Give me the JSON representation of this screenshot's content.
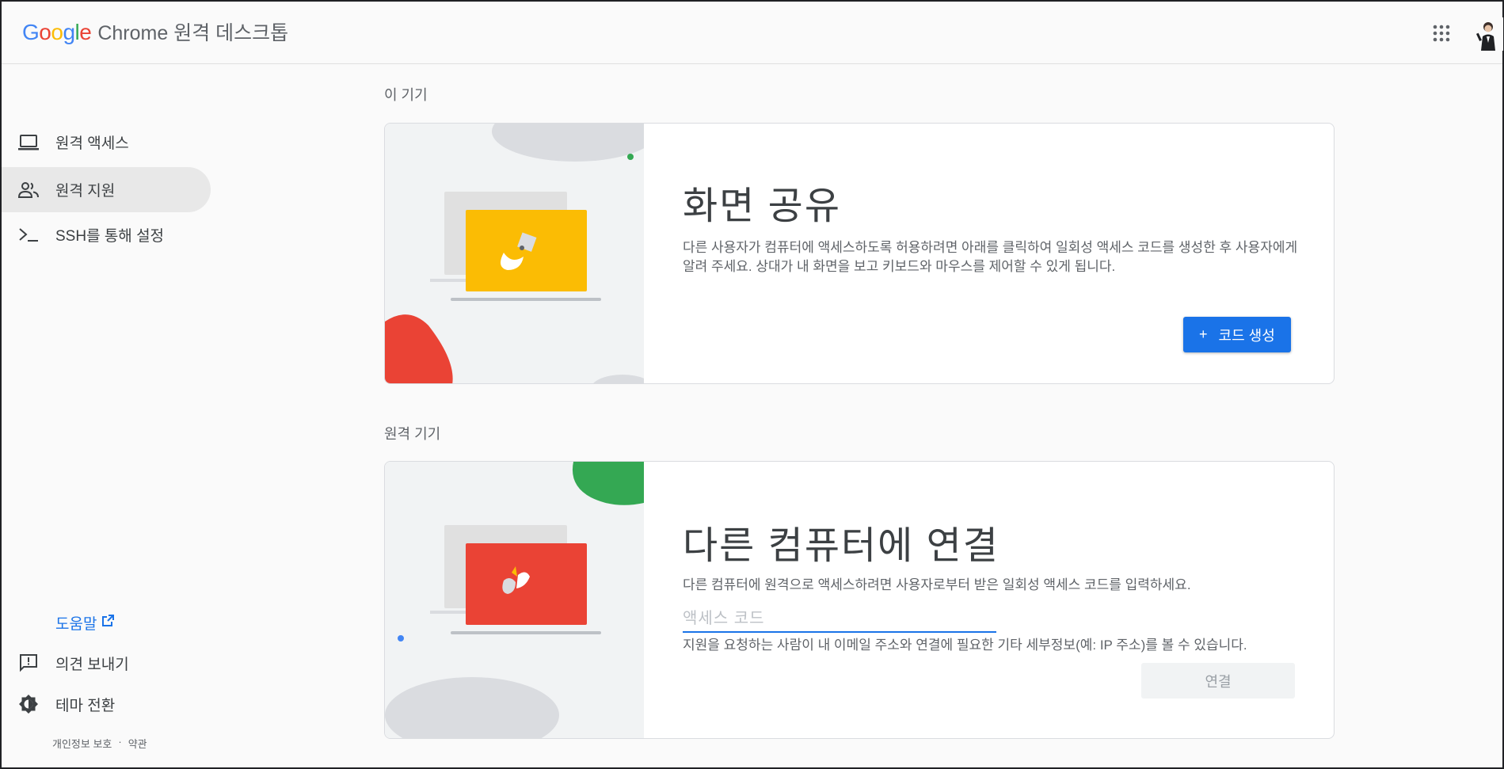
{
  "header": {
    "logo": {
      "G": "G",
      "o1": "o",
      "o2": "o",
      "g": "g",
      "l": "l",
      "e": "e"
    },
    "product_name": "Chrome 원격 데스크톱",
    "apps_icon": "apps-grid-icon",
    "avatar_icon": "account-avatar"
  },
  "sidebar": {
    "items": [
      {
        "label": "원격 액세스",
        "icon": "laptop-icon"
      },
      {
        "label": "원격 지원",
        "icon": "people-icon",
        "active": true
      },
      {
        "label": "SSH를 통해 설정",
        "icon": "terminal-icon"
      }
    ],
    "help_label": "도움말",
    "feedback_label": "의견 보내기",
    "theme_label": "테마 전환",
    "footer": {
      "privacy": "개인정보 보호",
      "separator": "·",
      "terms": "약관"
    }
  },
  "this_device": {
    "section_title": "이 기기",
    "card_title": "화면 공유",
    "description": "다른 사용자가 컴퓨터에 액세스하도록 허용하려면 아래를 클릭하여 일회성 액세스 코드를 생성한 후 사용자에게 알려 주세요. 상대가 내 화면을 보고 키보드와 마우스를 제어할 수 있게 됩니다.",
    "button_icon": "+",
    "button_label": "코드 생성"
  },
  "remote_device": {
    "section_title": "원격 기기",
    "card_title": "다른 컴퓨터에 연결",
    "description": "다른 컴퓨터에 원격으로 액세스하려면 사용자로부터 받은 일회성 액세스 코드를 입력하세요.",
    "input_placeholder": "액세스 코드",
    "input_value": "",
    "notice": "지원을 요청하는 사람이 내 이메일 주소와 연결에 필요한 기타 세부정보(예: IP 주소)를 볼 수 있습니다.",
    "connect_label": "연결"
  },
  "colors": {
    "accent": "#1a73e8",
    "yellow": "#fbbc04",
    "red": "#ea4335",
    "green": "#34a853"
  }
}
